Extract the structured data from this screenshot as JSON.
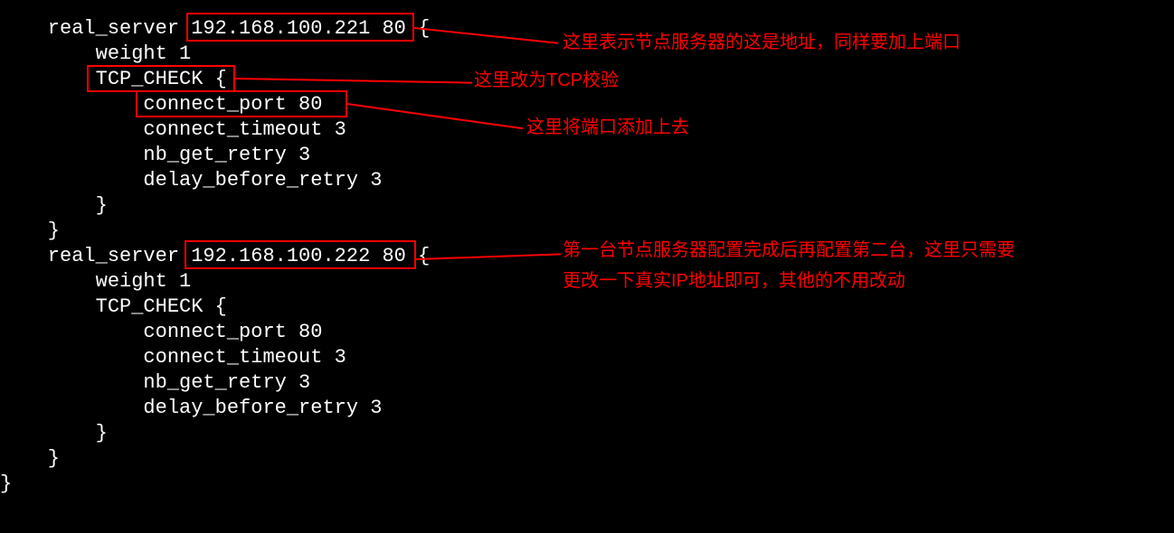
{
  "code": {
    "l1a": "    real_server ",
    "l1b": "192.168.100.221 80 {",
    "l2": "        weight 1",
    "l3": "        TCP_CHECK {",
    "l4": "            connect_port 80",
    "l5": "            connect_timeout 3",
    "l6": "            nb_get_retry 3",
    "l7": "            delay_before_retry 3",
    "l8": "        }",
    "l9": "    }",
    "l10a": "    real_server ",
    "l10b": "192.168.100.222 80 {",
    "l11": "        weight 1",
    "l12": "        TCP_CHECK {",
    "l13": "            connect_port 80",
    "l14": "            connect_timeout 3",
    "l15": "            nb_get_retry 3",
    "l16": "            delay_before_retry 3",
    "l17": "        }",
    "l18": "    }",
    "l19": "}"
  },
  "annotations": {
    "a1": "这里表示节点服务器的这是地址，同样要加上端口",
    "a2": "这里改为TCP校验",
    "a3": "这里将端口添加上去",
    "a4l1": "第一台节点服务器配置完成后再配置第二台，这里只需要",
    "a4l2": "更改一下真实IP地址即可，其他的不用改动"
  }
}
